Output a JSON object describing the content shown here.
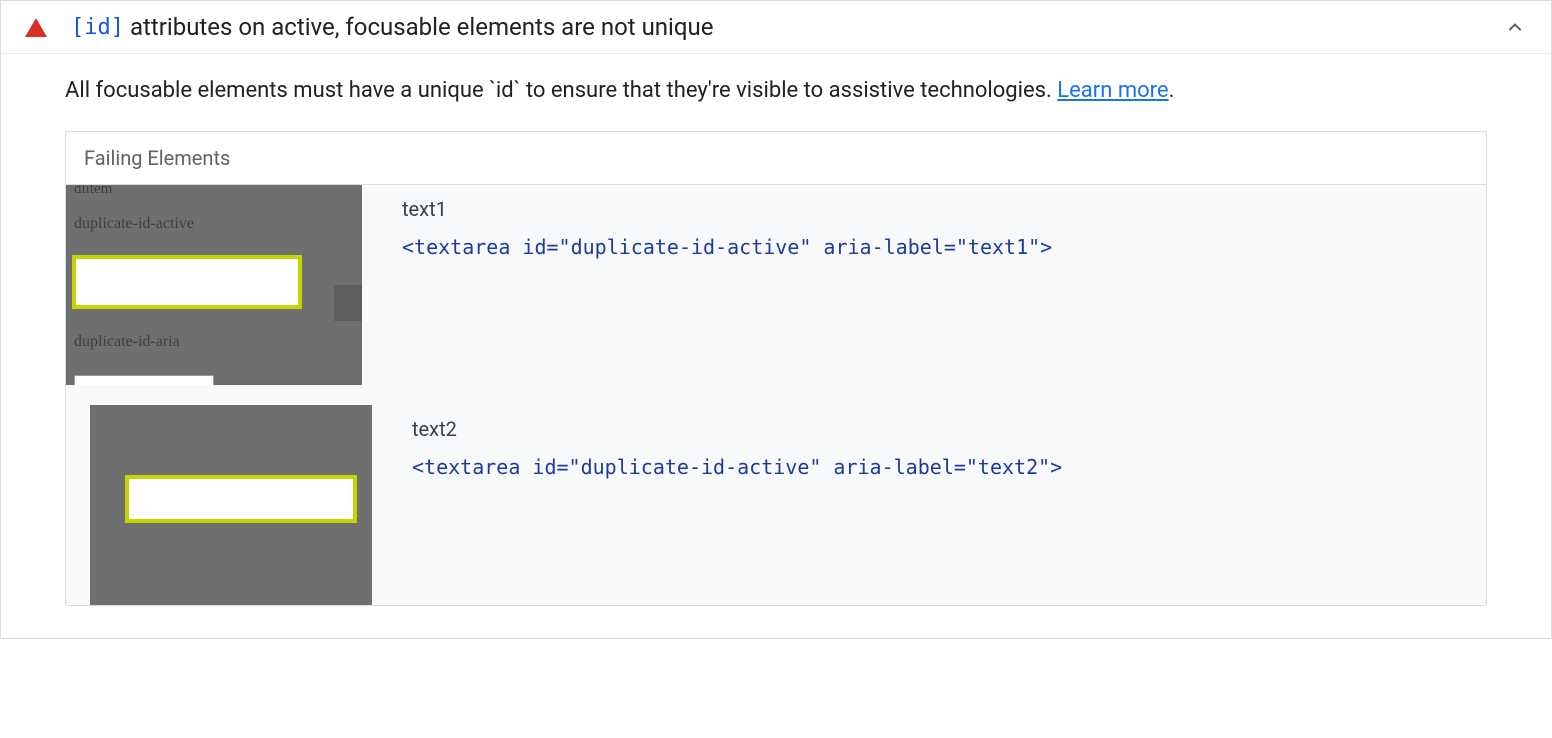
{
  "audit": {
    "title_code": "[id]",
    "title_text": " attributes on active, focusable elements are not unique",
    "description": "All focusable elements must have a unique `id` to ensure that they're visible to assistive technologies. ",
    "learn_more": "Learn more",
    "failing_header": "Failing Elements",
    "items": [
      {
        "label": "text1",
        "code": "<textarea id=\"duplicate-id-active\" aria-label=\"text1\">",
        "thumb": {
          "top": "dlitem",
          "lbl1": "duplicate-id-active",
          "lbl2": "duplicate-id-aria"
        }
      },
      {
        "label": "text2",
        "code": "<textarea id=\"duplicate-id-active\" aria-label=\"text2\">"
      }
    ]
  }
}
